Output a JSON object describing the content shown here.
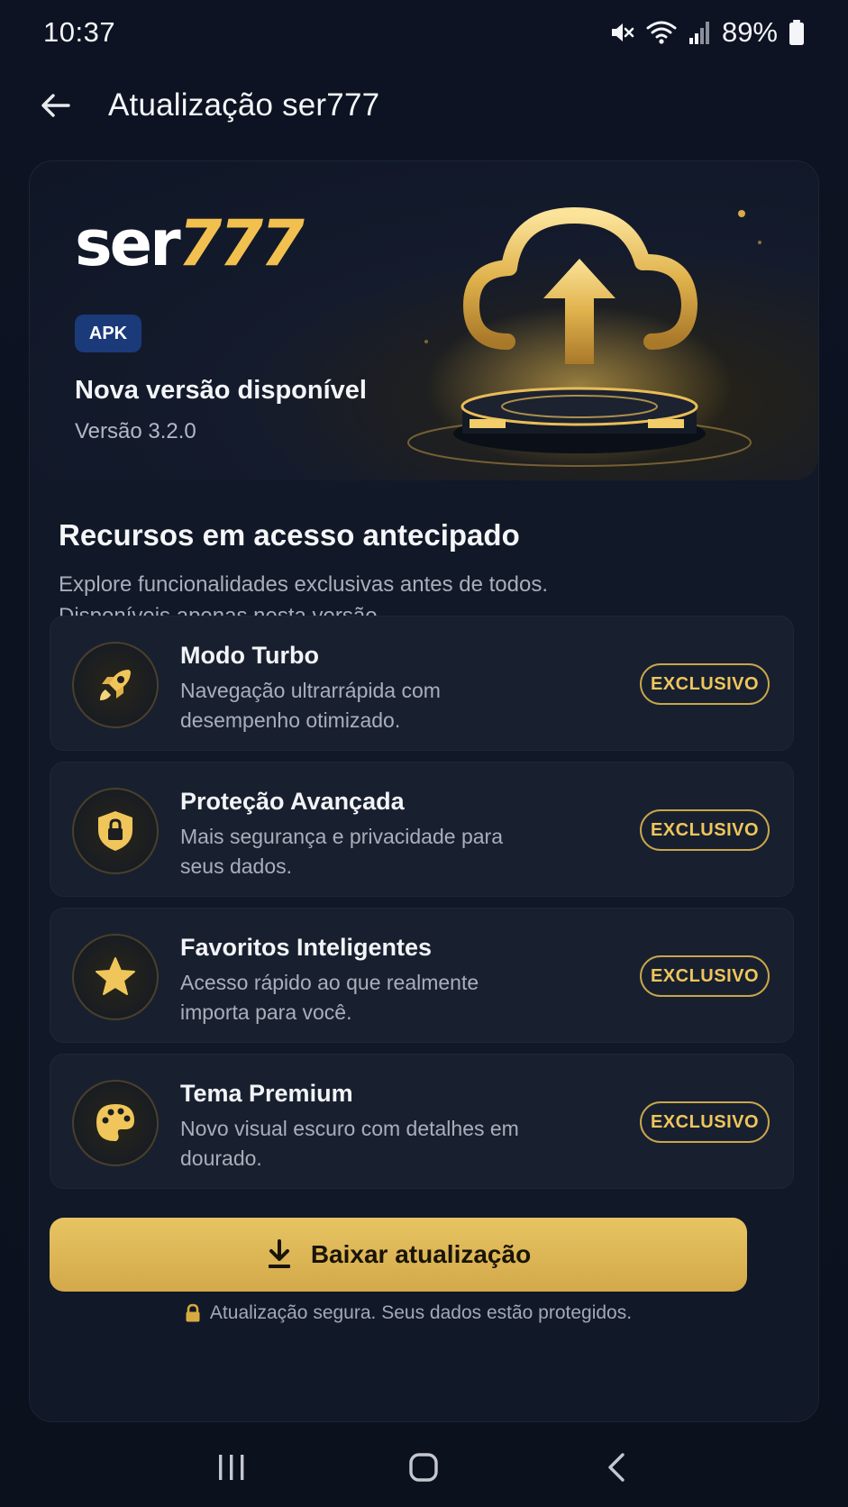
{
  "status_bar": {
    "time": "10:37",
    "battery": "89%"
  },
  "app_bar": {
    "title": "Atualização ser777"
  },
  "hero": {
    "brand_part1": "ser",
    "brand_part2": "777",
    "badge": "APK",
    "title": "Nova versão disponível",
    "version": "Versão 3.2.0"
  },
  "section": {
    "title": "Recursos em acesso antecipado",
    "description_lines": [
      "Explore funcionalidades exclusivas antes de todos.",
      "Disponíveis apenas nesta versão."
    ]
  },
  "features": [
    {
      "icon": "rocket-icon",
      "title": "Modo Turbo",
      "description": "Navegação ultrarrápida com desempenho otimizado.",
      "badge": "EXCLUSIVO"
    },
    {
      "icon": "shield-lock-icon",
      "title": "Proteção Avançada",
      "description": "Mais segurança e privacidade para seus dados.",
      "badge": "EXCLUSIVO"
    },
    {
      "icon": "star-icon",
      "title": "Favoritos Inteligentes",
      "description": "Acesso rápido ao que realmente importa para você.",
      "badge": "EXCLUSIVO"
    },
    {
      "icon": "palette-icon",
      "title": "Tema Premium",
      "description": "Novo visual escuro com detalhes em dourado.",
      "badge": "EXCLUSIVO"
    }
  ],
  "download": {
    "label": "Baixar atualização",
    "secure_note": "Atualização segura. Seus dados estão protegidos."
  },
  "colors": {
    "gold": "#f0c65a",
    "background": "#0c1220",
    "card": "#182030",
    "apk_badge": "#1b3a7a"
  }
}
